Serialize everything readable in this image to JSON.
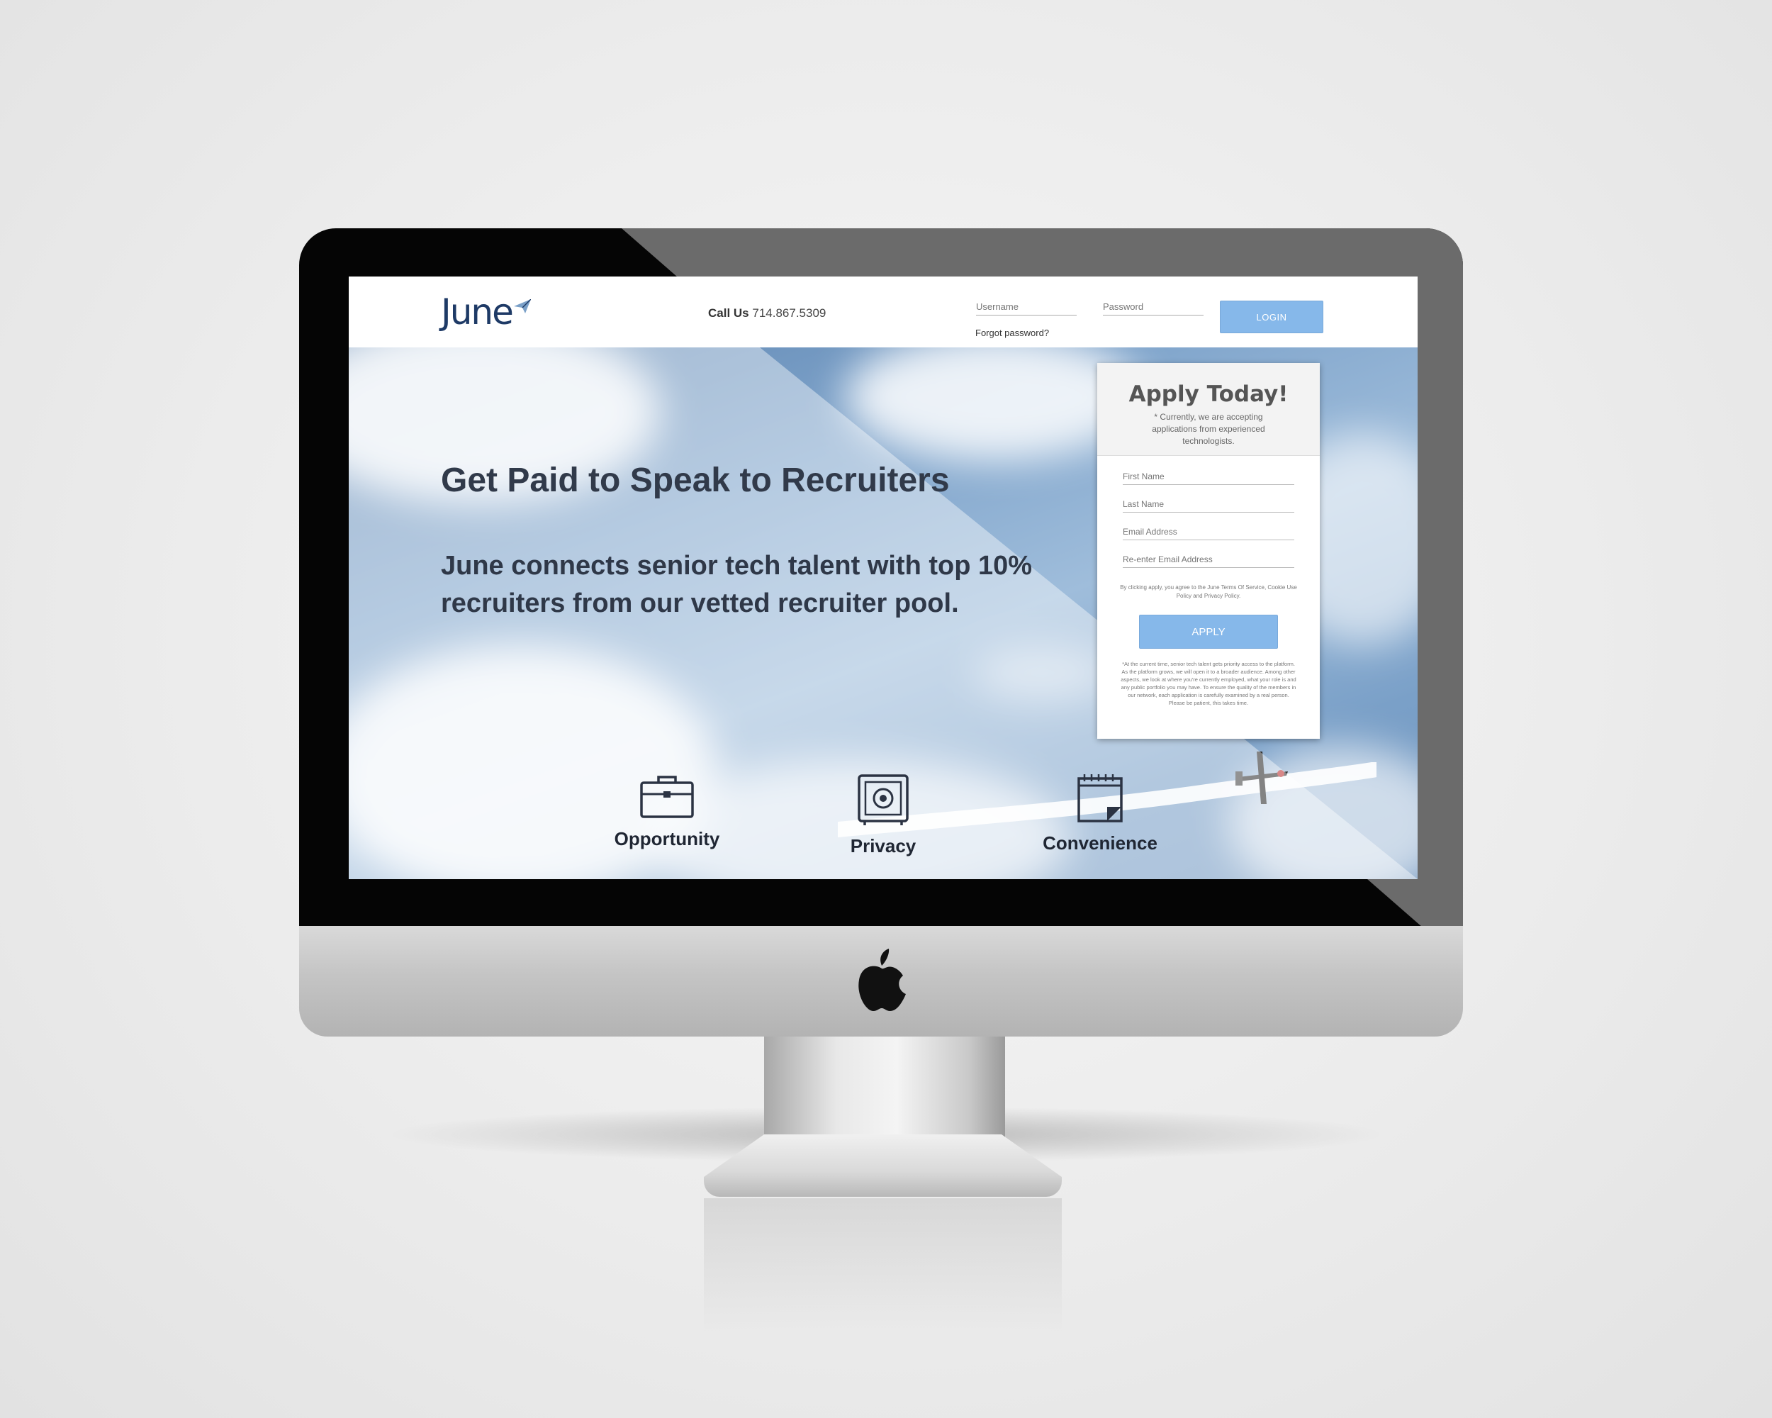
{
  "header": {
    "logo_text": "June",
    "call_us_label": "Call Us",
    "phone": "714.867.5309",
    "username_placeholder": "Username",
    "password_placeholder": "Password",
    "forgot_password": "Forgot password?",
    "login_label": "LOGIN"
  },
  "hero": {
    "title": "Get Paid to Speak to Recruiters",
    "subtitle": "June connects senior tech talent with top 10% recruiters from our vetted recruiter pool."
  },
  "features": [
    {
      "label": "Opportunity",
      "icon": "briefcase-icon"
    },
    {
      "label": "Privacy",
      "icon": "safe-icon"
    },
    {
      "label": "Convenience",
      "icon": "calendar-icon"
    }
  ],
  "apply_form": {
    "title": "Apply Today!",
    "note": "* Currently, we are accepting applications from experienced technologists.",
    "first_name_placeholder": "First Name",
    "last_name_placeholder": "Last Name",
    "email_placeholder": "Email Address",
    "email_confirm_placeholder": "Re-enter Email Address",
    "terms": "By clicking apply, you agree to the June Terms Of Service, Cookie Use Policy and Privacy Policy.",
    "apply_label": "APPLY",
    "footnote": "*At the current time, senior tech talent gets priority access to the platform. As the platform grows, we will open it to a broader audience. Among other aspects, we look at where you're currently employed, what your role is and any public portfolio you may have. To ensure the quality of the members in our network, each application is carefully examined by a real person. Please be patient, this takes time."
  },
  "colors": {
    "brand_navy": "#1e3a66",
    "button_blue": "#86b8ea",
    "sky_blue": "#7fa4cb"
  }
}
